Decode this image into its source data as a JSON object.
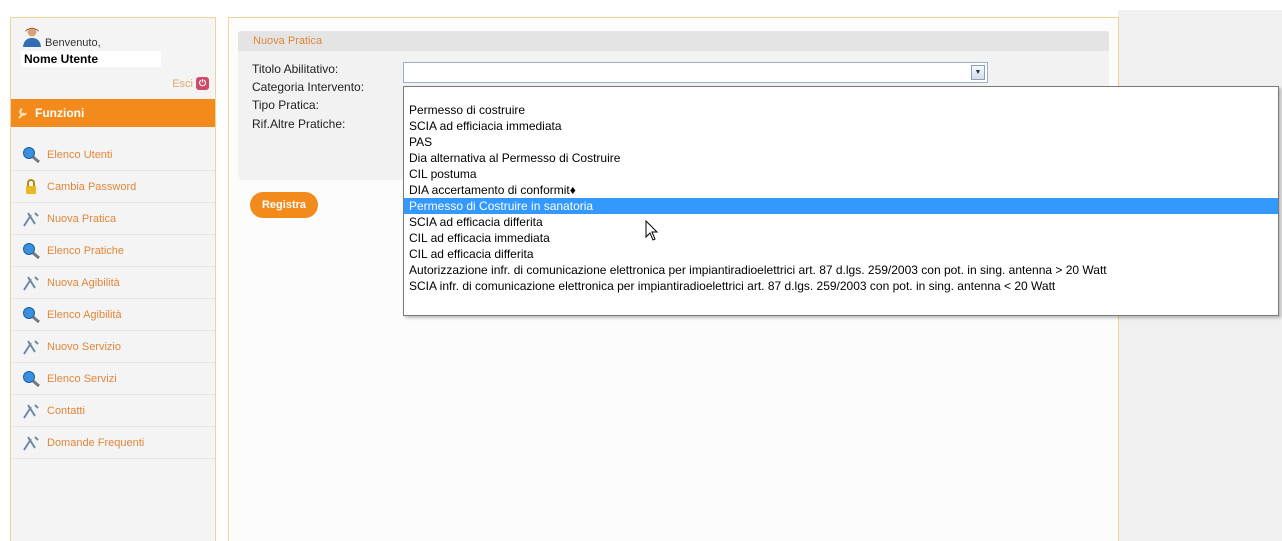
{
  "sidebar": {
    "welcome": "Benvenuto,",
    "username": "Nome Utente",
    "exit_label": "Esci",
    "functions_header": "Funzioni",
    "items": [
      {
        "label": "Elenco Utenti",
        "icon": "user-search-icon"
      },
      {
        "label": "Cambia Password",
        "icon": "lock-icon"
      },
      {
        "label": "Nuova Pratica",
        "icon": "tools-icon"
      },
      {
        "label": "Elenco Pratiche",
        "icon": "user-search-icon"
      },
      {
        "label": "Nuova Agibilità",
        "icon": "tools-icon"
      },
      {
        "label": "Elenco Agibilità",
        "icon": "user-search-icon"
      },
      {
        "label": "Nuovo Servizio",
        "icon": "tools-icon"
      },
      {
        "label": "Elenco Servizi",
        "icon": "user-search-icon"
      },
      {
        "label": "Contatti",
        "icon": "tools-icon"
      },
      {
        "label": "Domande Frequenti",
        "icon": "tools-icon"
      }
    ]
  },
  "form": {
    "section_title": "Nuova Pratica",
    "labels": {
      "titolo": "Titolo Abilitativo:",
      "categoria": "Categoria Intervento:",
      "tipo": "Tipo Pratica:",
      "rif": "Rif.Altre Pratiche:"
    },
    "titolo_value": "",
    "register_label": "Registra"
  },
  "dropdown": {
    "selected_index": 6,
    "options": [
      "Permesso di costruire",
      "SCIA ad efficiacia immediata",
      "PAS",
      "Dia alternativa al Permesso di Costruire",
      "CIL postuma",
      "DIA accertamento di conformit♦",
      "Permesso di Costruire in sanatoria",
      "SCIA ad efficacia differita",
      "CIL ad efficacia immediata",
      "CIL ad efficacia differita",
      "Autorizzazione infr. di comunicazione elettronica per impiantiradioelettrici art. 87 d.lgs. 259/2003 con pot. in sing. antenna > 20 Watt",
      "SCIA infr. di comunicazione elettronica per impiantiradioelettrici art. 87 d.lgs. 259/2003 con pot. in sing. antenna < 20 Watt"
    ]
  },
  "colors": {
    "accent_orange": "#f28a1c",
    "menu_link": "#e2863a",
    "selection_blue": "#3399ff"
  }
}
